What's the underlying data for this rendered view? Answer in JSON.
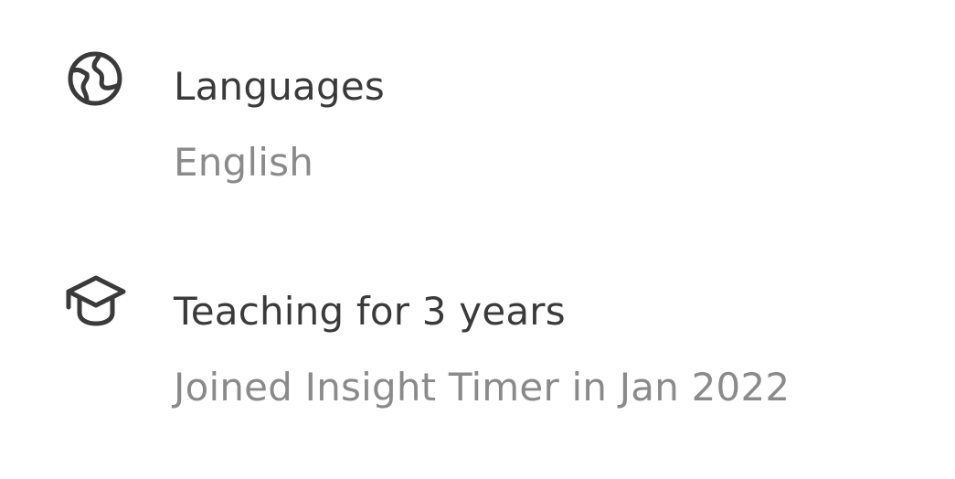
{
  "languages": {
    "icon": "globe-icon",
    "title": "Languages",
    "value": "English"
  },
  "teaching": {
    "icon": "graduation-cap-icon",
    "title": "Teaching for 3 years",
    "value": "Joined Insight Timer in Jan 2022"
  },
  "colors": {
    "primary_text": "#3a3a3a",
    "secondary_text": "#8a8a8a",
    "background": "#ffffff"
  }
}
